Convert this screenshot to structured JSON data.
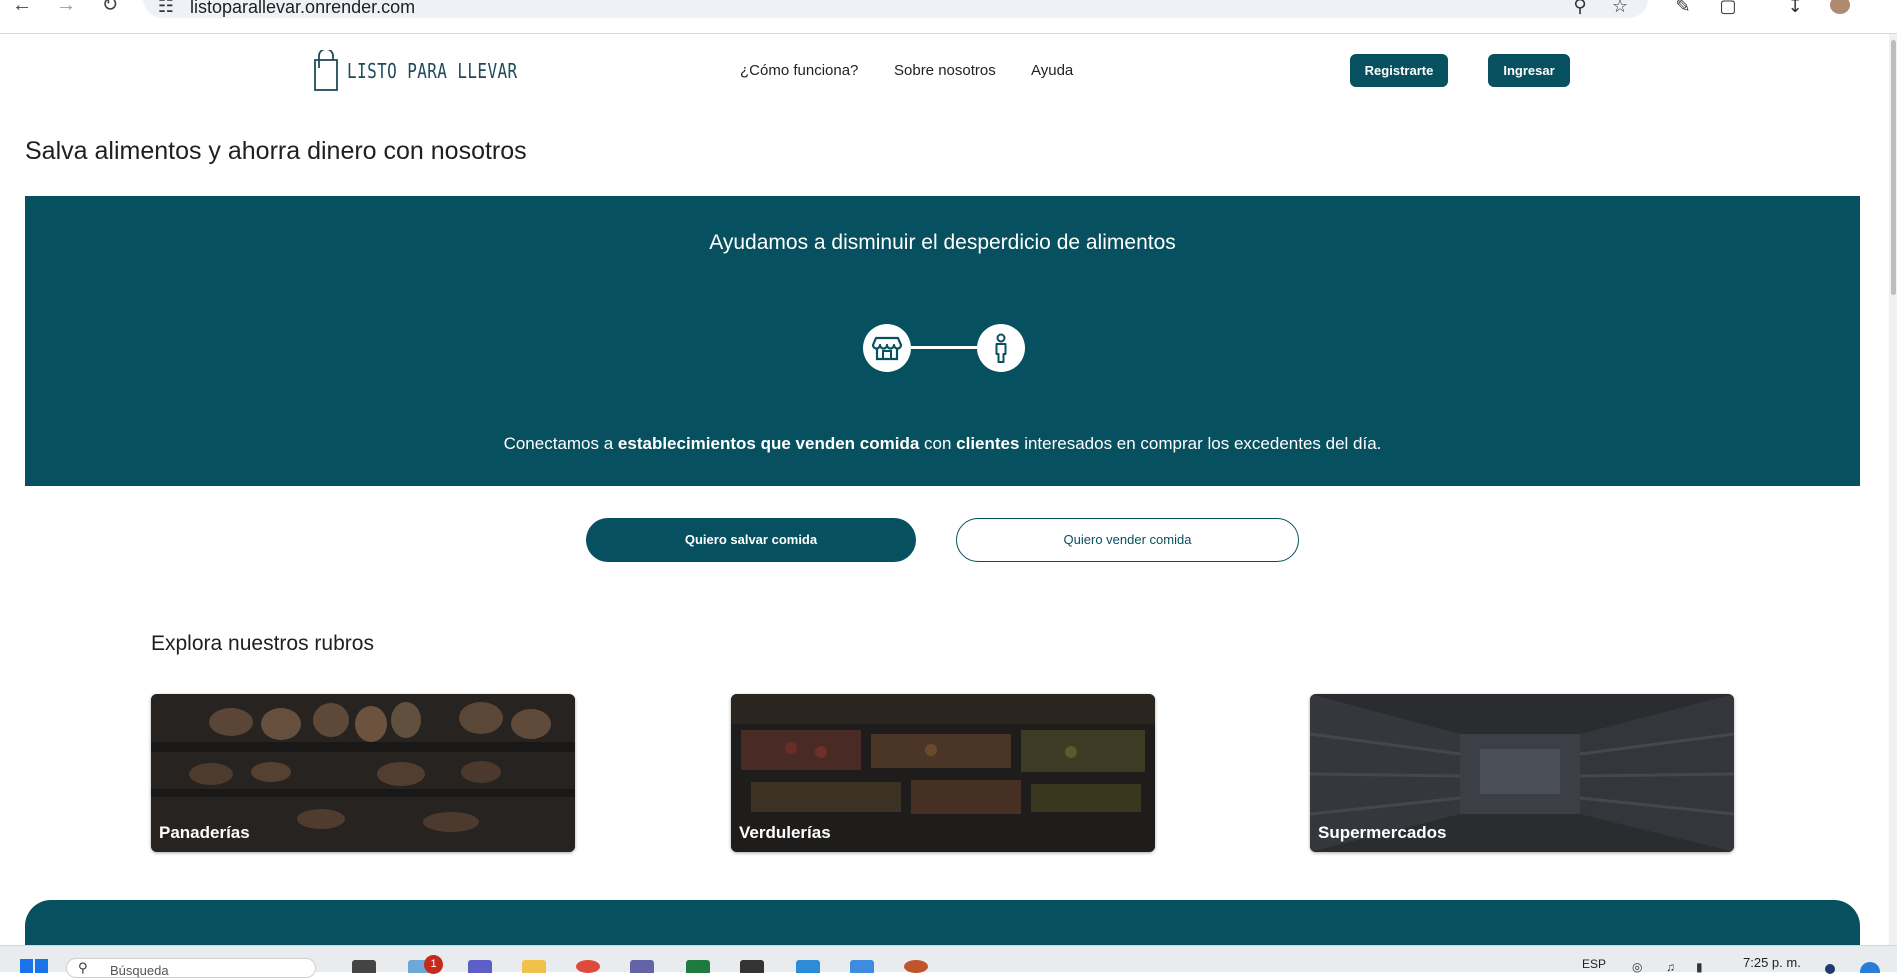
{
  "browser": {
    "url": "listoparallevar.onrender.com"
  },
  "nav": {
    "logo_text": "LISTO PARA LLEVAR",
    "links": [
      "¿Cómo funciona?",
      "Sobre nosotros",
      "Ayuda"
    ],
    "register_label": "Registrarte",
    "login_label": "Ingresar"
  },
  "headline": "Salva alimentos y ahorra dinero con nosotros",
  "hero": {
    "title": "Ayudamos a disminuir el desperdicio de alimentos",
    "desc_part1": "Conectamos a ",
    "desc_bold1": "establecimientos que venden comida",
    "desc_part2": " con ",
    "desc_bold2": "clientes",
    "desc_part3": " interesados en comprar los excedentes del día."
  },
  "cta": {
    "save_label": "Quiero salvar comida",
    "sell_label": "Quiero vender comida"
  },
  "explore": {
    "title": "Explora nuestros rubros",
    "categories": [
      "Panaderías",
      "Verdulerías",
      "Supermercados"
    ]
  },
  "taskbar": {
    "search_placeholder": "Búsqueda",
    "notification_count": "1",
    "language": "ESP",
    "time": "7:25 p. m."
  },
  "colors": {
    "brand": "#07505f",
    "text": "#1f1f1f"
  }
}
